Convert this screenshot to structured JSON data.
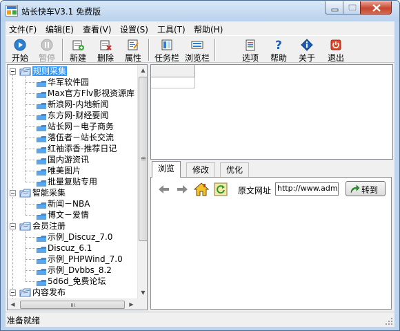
{
  "window": {
    "title": "站长快车V3.1 免费版"
  },
  "menu": [
    {
      "label": "文件(F)"
    },
    {
      "label": "编辑(E)"
    },
    {
      "label": "查看(V)"
    },
    {
      "label": "设置(S)"
    },
    {
      "label": "工具(T)"
    },
    {
      "label": "帮助(H)"
    }
  ],
  "toolbar": {
    "start": "开始",
    "pause": "暂停",
    "new": "新建",
    "delete": "删除",
    "properties": "属性",
    "taskbar": "任务栏",
    "browserbar": "浏览栏",
    "options": "选项",
    "help": "帮助",
    "about": "关于",
    "exit": "退出"
  },
  "tree": [
    {
      "label": "规则采集",
      "selected": true,
      "children": [
        "华军软件园",
        "Max官方Flv影视资源库",
        "新浪网-内地新闻",
        "东方网-财经要闻",
        "站长网－电子商务",
        "落伍者－站长交流",
        "红袖添香-推荐日记",
        "国内游资讯",
        "唯美图片",
        "批量复贴专用"
      ]
    },
    {
      "label": "智能采集",
      "children": [
        "新闻－NBA",
        "博文－爱情"
      ]
    },
    {
      "label": "会员注册",
      "children": [
        "示例_Discuz_7.0",
        "Discuz_6.1",
        "示例_PHPWind_7.0",
        "示例_Dvbbs_8.2",
        "5d6d_免费论坛"
      ]
    },
    {
      "label": "内容发布",
      "children": []
    }
  ],
  "tabs": [
    {
      "label": "浏览"
    },
    {
      "label": "修改"
    },
    {
      "label": "优化"
    }
  ],
  "browser": {
    "url_label": "原文网址",
    "url_value": "http://www.admin",
    "go_label": "转到"
  },
  "status": {
    "text": "准备就绪"
  },
  "colors": {
    "selection": "#3399ff",
    "title_bar": "#b9d1ec",
    "close_button": "#c8452f"
  }
}
